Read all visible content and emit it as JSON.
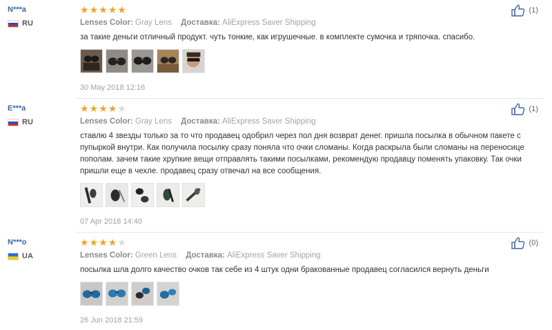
{
  "reviews": [
    {
      "user": "N***a",
      "country": "RU",
      "rating": 5,
      "attributes": [
        {
          "label": "Lenses Color:",
          "value": "Gray Lens"
        },
        {
          "label": "Доставка:",
          "value": "AliExpress Saver Shipping"
        }
      ],
      "text": "за такие деньги отличный продукт. чуть тонкие, как игрушечные. в комплекте сумочка и тряпочка. спасибо.",
      "photos": [
        "photo-sunglasses-case",
        "photo-sunglasses-dark",
        "photo-sunglasses-dark",
        "photo-sunglasses-table",
        "photo-person-wearing"
      ],
      "date": "30 May 2018 12:16",
      "likes": "(1)"
    },
    {
      "user": "E***a",
      "country": "RU",
      "rating": 4,
      "attributes": [
        {
          "label": "Lenses Color:",
          "value": "Gray Lens"
        },
        {
          "label": "Доставка:",
          "value": "AliExpress Saver Shipping"
        }
      ],
      "text": "ставлю 4 звезды только за то что продавец одобрил через пол дня возврат денег. пришла посылка в обычном пакете с пупыркой внутри. Как получила посылку сразу поняла что очки сломаны. Когда раскрыла были сломаны на переносице пополам. зачем такие хрупкие вещи отправлять такими посылками, рекомендую продавцу поменять упаковку. Так очки пришли еще в чехле. продавец сразу отвечал на все сообщения.",
      "photos": [
        "photo-broken-glasses",
        "photo-broken-glasses",
        "photo-broken-glasses",
        "photo-broken-glasses",
        "photo-broken-glasses"
      ],
      "date": "07 Apr 2018 14:40",
      "likes": "(1)"
    },
    {
      "user": "N***o",
      "country": "UA",
      "rating": 4,
      "attributes": [
        {
          "label": "Lenses Color:",
          "value": "Green Lens"
        },
        {
          "label": "Доставка:",
          "value": "AliExpress Saver Shipping"
        }
      ],
      "text": "посылка шла долго качество очков так себе из 4 штук одни бракованные продавец согласился вернуть деньги",
      "photos": [
        "photo-blue-lens-glasses",
        "photo-blue-lens-glasses",
        "photo-blue-lens-glasses",
        "photo-blue-lens-glasses"
      ],
      "date": "26 Jun 2018 21:59",
      "likes": "(0)"
    }
  ],
  "colors": {
    "user_name": "#3a65b0",
    "star_on": "#f7a21f",
    "star_off": "#d9d9d9",
    "muted_text": "#a0a0a0"
  },
  "icons": {
    "like": "thumbs-up-icon",
    "star": "star-icon"
  }
}
